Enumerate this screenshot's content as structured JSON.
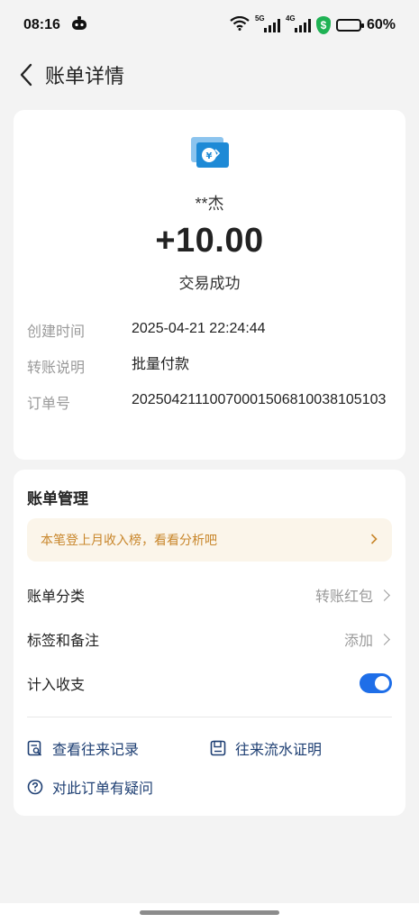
{
  "status_bar": {
    "time": "08:16",
    "net1": "5G",
    "net2": "4G",
    "battery": "60%",
    "battery_level": 0.6,
    "icons": [
      "app-notification-icon",
      "wifi-icon",
      "signal-5g-icon",
      "signal-4g-icon",
      "security-shield-icon",
      "battery-icon"
    ]
  },
  "header": {
    "title": "账单详情"
  },
  "transaction": {
    "payee": "**杰",
    "amount": "+10.00",
    "status": "交易成功",
    "icon": "transfer-yuan-icon",
    "accent": "#1e8ad6",
    "details": [
      {
        "label": "创建时间",
        "value": "2025-04-21 22:24:44"
      },
      {
        "label": "转账说明",
        "value": "批量付款"
      },
      {
        "label": "订单号",
        "value": "20250421110070001506810038105103"
      }
    ]
  },
  "management": {
    "title": "账单管理",
    "promo": "本笔登上月收入榜，看看分析吧",
    "rows": [
      {
        "label": "账单分类",
        "value": "转账红包"
      },
      {
        "label": "标签和备注",
        "value": "添加"
      },
      {
        "label": "计入收支",
        "toggle": true
      }
    ],
    "links": [
      {
        "label": "查看往来记录",
        "icon": "record-search-icon"
      },
      {
        "label": "往来流水证明",
        "icon": "statement-certificate-icon"
      },
      {
        "label": "对此订单有疑问",
        "icon": "question-icon"
      }
    ],
    "toggle_color": "#1e6ee8",
    "promo_color": "#c8862b"
  }
}
